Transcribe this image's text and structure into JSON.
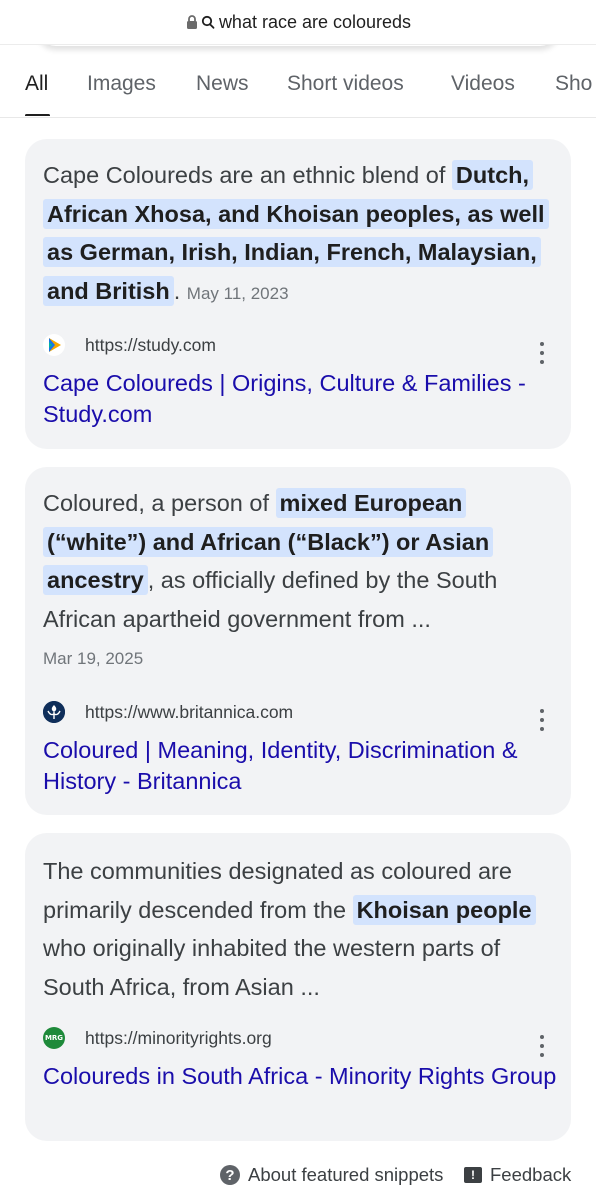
{
  "urlbar": {
    "query": "what race are coloureds",
    "lock_icon": "lock-icon",
    "search_icon": "search-icon"
  },
  "tabs": [
    {
      "label": "All",
      "active": true
    },
    {
      "label": "Images"
    },
    {
      "label": "News"
    },
    {
      "label": "Short videos"
    },
    {
      "label": "Videos"
    },
    {
      "label": "Sho"
    }
  ],
  "results": [
    {
      "snippet_before": "Cape Coloureds are an ethnic blend of",
      "snippet_highlight": "Dutch, African Xhosa, and Khoisan peoples, as well as German, Irish, Indian, French, Malaysian, and British",
      "snippet_after": ".",
      "date": "May 11, 2023",
      "source_url": "https://study.com",
      "title": "Cape Coloureds | Origins, Culture & Families - Study.com",
      "favicon": "study-com-icon",
      "favicon_color": "#1a73e8"
    },
    {
      "snippet_before": "Coloured, a person of",
      "snippet_highlight": "mixed European (“white”) and African (“Black”) or Asian ancestry",
      "snippet_after": ", as officially defined by the South African apartheid government from ...",
      "date": "Mar 19, 2025",
      "source_url": "https://www.britannica.com",
      "title": "Coloured | Meaning, Identity, Discrimination & History - Britannica",
      "favicon": "britannica-thistle-icon",
      "favicon_color": "#0f2e5a"
    },
    {
      "snippet_before": "The communities designated as coloured are primarily descended from the",
      "snippet_highlight": "Khoisan people",
      "snippet_after": "who originally inhabited the western parts of South Africa, from Asian ...",
      "source_url": "https://minorityrights.org",
      "title": "Coloureds in South Africa - Minority Rights Group",
      "favicon": "mrg-icon",
      "favicon_text": "MRG",
      "favicon_color": "#1e8a3a"
    }
  ],
  "footer": {
    "about_label": "About featured snippets",
    "feedback_label": "Feedback"
  },
  "colors": {
    "link": "#1a0dab",
    "highlight": "#d3e3fd",
    "card_bg": "#f2f3f5"
  }
}
